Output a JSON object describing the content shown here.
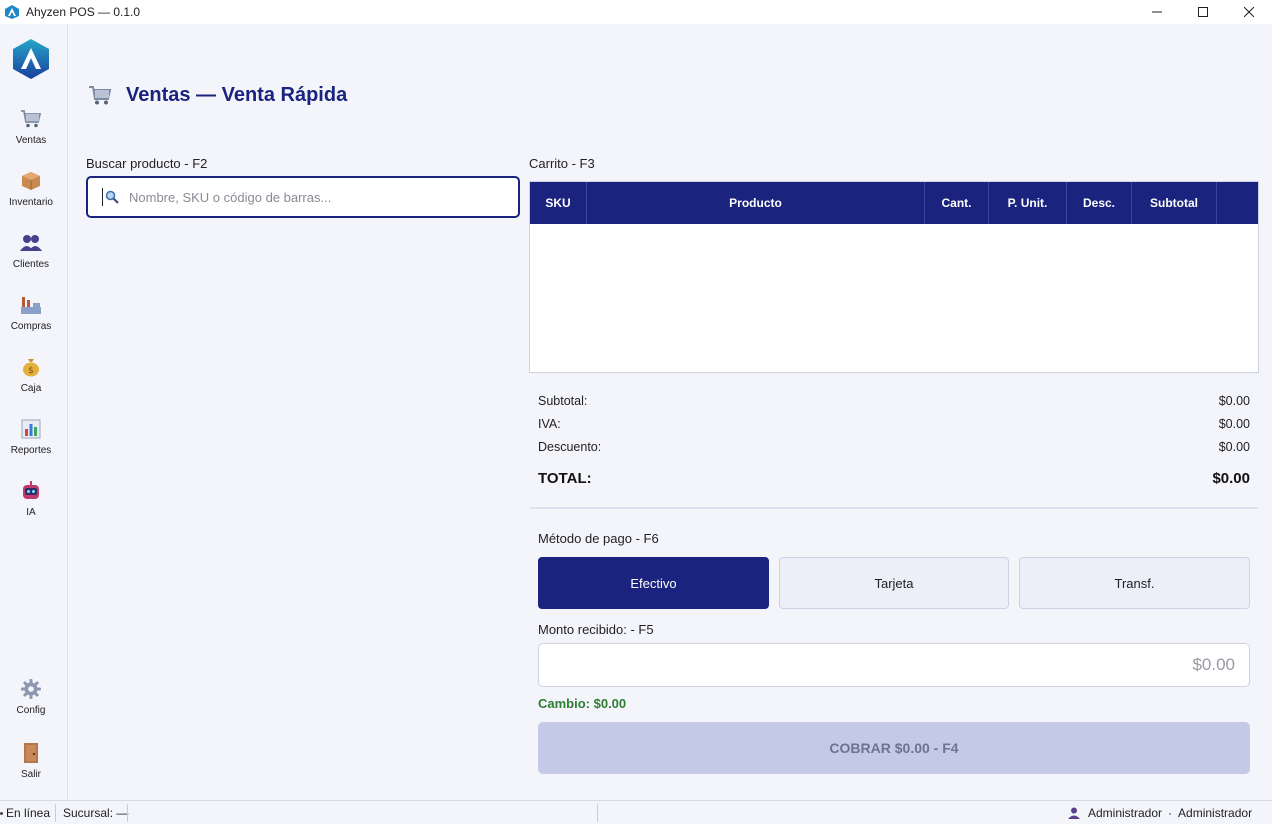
{
  "window": {
    "title": "Ahyzen POS — 0.1.0",
    "controls": {
      "minimize": "minimize-icon",
      "maximize": "maximize-icon",
      "close": "close-icon"
    }
  },
  "sidebar": {
    "items": [
      {
        "label": "Ventas",
        "icon": "cart-icon"
      },
      {
        "label": "Inventario",
        "icon": "box-icon"
      },
      {
        "label": "Clientes",
        "icon": "users-icon"
      },
      {
        "label": "Compras",
        "icon": "factory-icon"
      },
      {
        "label": "Caja",
        "icon": "money-bag-icon"
      },
      {
        "label": "Reportes",
        "icon": "chart-icon"
      },
      {
        "label": "IA",
        "icon": "robot-icon"
      }
    ],
    "bottom_items": [
      {
        "label": "Config",
        "icon": "gear-icon"
      },
      {
        "label": "Salir",
        "icon": "door-icon"
      }
    ]
  },
  "header": {
    "title": "Ventas — Venta Rápida"
  },
  "search": {
    "label": "Buscar producto - F2",
    "placeholder": "Nombre, SKU o código de barras...",
    "value": ""
  },
  "cart": {
    "label": "Carrito - F3",
    "columns": [
      "SKU",
      "Producto",
      "Cant.",
      "P. Unit.",
      "Desc.",
      "Subtotal"
    ],
    "rows": []
  },
  "totals": {
    "subtotal_label": "Subtotal:",
    "subtotal_value": "$0.00",
    "iva_label": "IVA:",
    "iva_value": "$0.00",
    "discount_label": "Descuento:",
    "discount_value": "$0.00",
    "total_label": "TOTAL:",
    "total_value": "$0.00"
  },
  "payment": {
    "label": "Método de pago - F6",
    "methods": [
      "Efectivo",
      "Tarjeta",
      "Transf."
    ],
    "selected": "Efectivo"
  },
  "amount": {
    "label": "Monto recibido: - F5",
    "placeholder": "$0.00",
    "value": ""
  },
  "change": {
    "text": "Cambio: $0.00"
  },
  "charge_button": {
    "label": "COBRAR  $0.00 - F4"
  },
  "colors": {
    "primary": "#1a237e",
    "success": "#2e7d32",
    "disabled": "#c5c9e8"
  },
  "status": {
    "connection": "En línea",
    "branch": "Sucursal: —",
    "user": "Administrador",
    "role": "Administrador",
    "separator": "·"
  }
}
